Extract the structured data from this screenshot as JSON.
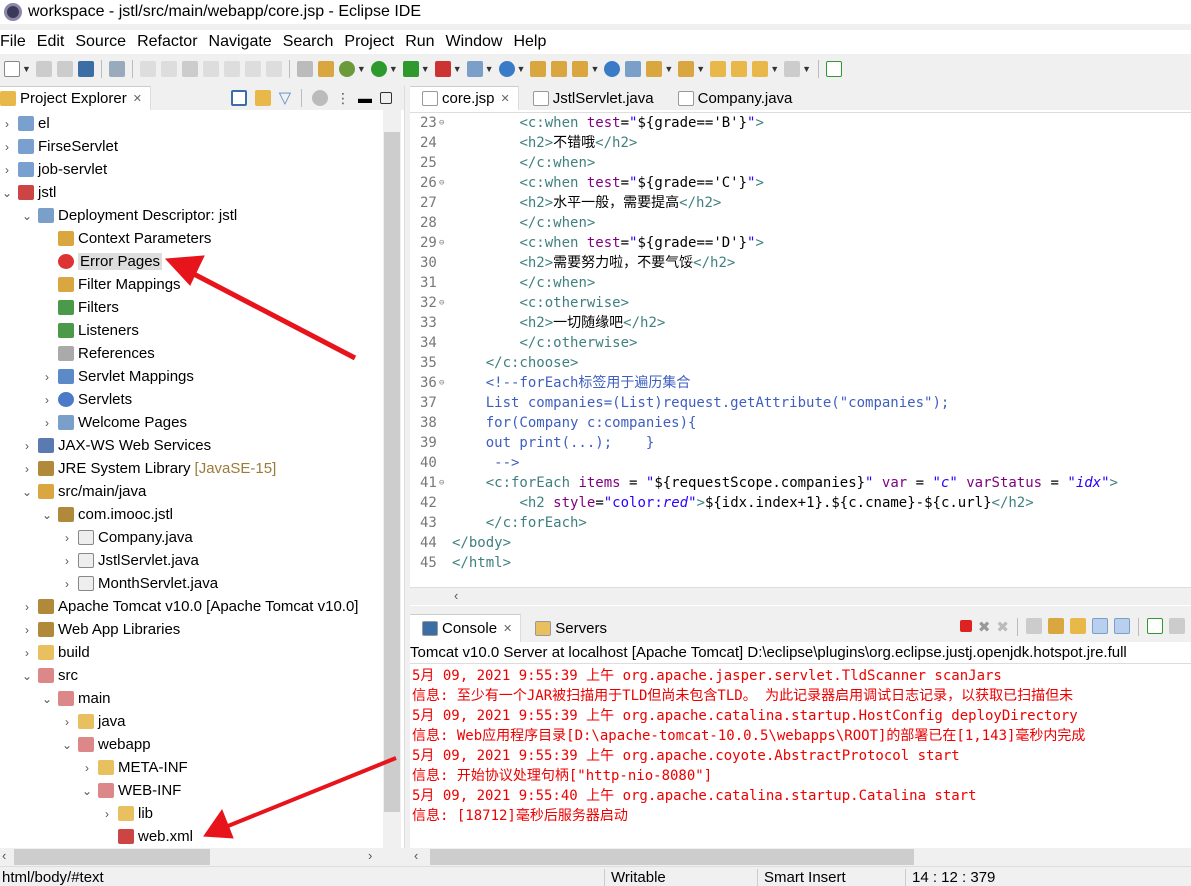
{
  "window": {
    "title": "workspace - jstl/src/main/webapp/core.jsp - Eclipse IDE"
  },
  "menu": [
    "File",
    "Edit",
    "Source",
    "Refactor",
    "Navigate",
    "Search",
    "Project",
    "Run",
    "Window",
    "Help"
  ],
  "explorer": {
    "title": "Project Explorer",
    "items": [
      {
        "label": "el",
        "level": 0,
        "twisty": "closed",
        "icon": "web-project-icon"
      },
      {
        "label": "FirseServlet",
        "level": 0,
        "twisty": "closed",
        "icon": "web-project-icon"
      },
      {
        "label": "job-servlet",
        "level": 0,
        "twisty": "closed",
        "icon": "web-project-icon"
      },
      {
        "label": "jstl",
        "level": 0,
        "twisty": "open",
        "icon": "web-project-error-icon"
      },
      {
        "label": "Deployment Descriptor: jstl",
        "level": 1,
        "twisty": "open",
        "icon": "deployment-descriptor-icon"
      },
      {
        "label": "Context Parameters",
        "level": 2,
        "twisty": "none",
        "icon": "context-params-icon"
      },
      {
        "label": "Error Pages",
        "level": 2,
        "twisty": "none",
        "icon": "error-pages-icon",
        "selected": true
      },
      {
        "label": "Filter Mappings",
        "level": 2,
        "twisty": "none",
        "icon": "filter-mappings-icon"
      },
      {
        "label": "Filters",
        "level": 2,
        "twisty": "none",
        "icon": "filters-icon"
      },
      {
        "label": "Listeners",
        "level": 2,
        "twisty": "none",
        "icon": "listeners-icon"
      },
      {
        "label": "References",
        "level": 2,
        "twisty": "none",
        "icon": "references-icon"
      },
      {
        "label": "Servlet Mappings",
        "level": 2,
        "twisty": "closed",
        "icon": "servlet-mappings-icon"
      },
      {
        "label": "Servlets",
        "level": 2,
        "twisty": "closed",
        "icon": "servlets-icon"
      },
      {
        "label": "Welcome Pages",
        "level": 2,
        "twisty": "closed",
        "icon": "welcome-pages-icon"
      },
      {
        "label": "JAX-WS Web Services",
        "level": 1,
        "twisty": "closed",
        "icon": "web-services-icon"
      },
      {
        "label": "JRE System Library",
        "deco": "[JavaSE-15]",
        "level": 1,
        "twisty": "closed",
        "icon": "library-icon"
      },
      {
        "label": "src/main/java",
        "level": 1,
        "twisty": "open",
        "icon": "source-folder-icon"
      },
      {
        "label": "com.imooc.jstl",
        "level": 2,
        "twisty": "open",
        "icon": "package-icon"
      },
      {
        "label": "Company.java",
        "level": 3,
        "twisty": "closed",
        "icon": "java-file-icon"
      },
      {
        "label": "JstlServlet.java",
        "level": 3,
        "twisty": "closed",
        "icon": "java-file-icon"
      },
      {
        "label": "MonthServlet.java",
        "level": 3,
        "twisty": "closed",
        "icon": "java-file-icon"
      },
      {
        "label": "Apache Tomcat v10.0 [Apache Tomcat v10.0]",
        "level": 1,
        "twisty": "closed",
        "icon": "library-icon"
      },
      {
        "label": "Web App Libraries",
        "level": 1,
        "twisty": "closed",
        "icon": "library-icon"
      },
      {
        "label": "build",
        "level": 1,
        "twisty": "closed",
        "icon": "folder-icon"
      },
      {
        "label": "src",
        "level": 1,
        "twisty": "open",
        "icon": "folder-error-icon"
      },
      {
        "label": "main",
        "level": 2,
        "twisty": "open",
        "icon": "folder-error-icon"
      },
      {
        "label": "java",
        "level": 3,
        "twisty": "closed",
        "icon": "folder-icon"
      },
      {
        "label": "webapp",
        "level": 3,
        "twisty": "open",
        "icon": "folder-error-icon"
      },
      {
        "label": "META-INF",
        "level": 4,
        "twisty": "closed",
        "icon": "folder-icon"
      },
      {
        "label": "WEB-INF",
        "level": 4,
        "twisty": "open",
        "icon": "folder-error-icon"
      },
      {
        "label": "lib",
        "level": 5,
        "twisty": "closed",
        "icon": "folder-icon"
      },
      {
        "label": "web.xml",
        "level": 5,
        "twisty": "none",
        "icon": "xml-file-error-icon"
      }
    ]
  },
  "editor": {
    "tabs": [
      {
        "label": "core.jsp",
        "active": true
      },
      {
        "label": "JstlServlet.java"
      },
      {
        "label": "Company.java"
      }
    ],
    "lines": [
      {
        "n": "23",
        "fold": true,
        "tokens": [
          [
            "tag",
            "\t\t<c:when "
          ],
          [
            "attr",
            "test"
          ],
          [
            "el",
            "="
          ],
          [
            "str",
            "\""
          ],
          [
            "el",
            "${grade=='B'}"
          ],
          [
            "str",
            "\""
          ],
          [
            "tag",
            ">"
          ]
        ]
      },
      {
        "n": "24",
        "tokens": [
          [
            "tag",
            "\t\t<h2>"
          ],
          [
            "txt",
            "不错哦"
          ],
          [
            "tag",
            "</h2>"
          ]
        ]
      },
      {
        "n": "25",
        "tokens": [
          [
            "tag",
            "\t\t</c:when>"
          ]
        ]
      },
      {
        "n": "26",
        "fold": true,
        "tokens": [
          [
            "tag",
            "\t\t<c:when "
          ],
          [
            "attr",
            "test"
          ],
          [
            "el",
            "="
          ],
          [
            "str",
            "\""
          ],
          [
            "el",
            "${grade=='C'}"
          ],
          [
            "str",
            "\""
          ],
          [
            "tag",
            ">"
          ]
        ]
      },
      {
        "n": "27",
        "tokens": [
          [
            "tag",
            "\t\t<h2>"
          ],
          [
            "txt",
            "水平一般，需要提高"
          ],
          [
            "tag",
            "</h2>"
          ]
        ]
      },
      {
        "n": "28",
        "tokens": [
          [
            "tag",
            "\t\t</c:when>"
          ]
        ]
      },
      {
        "n": "29",
        "fold": true,
        "tokens": [
          [
            "tag",
            "\t\t<c:when "
          ],
          [
            "attr",
            "test"
          ],
          [
            "el",
            "="
          ],
          [
            "str",
            "\""
          ],
          [
            "el",
            "${grade=='D'}"
          ],
          [
            "str",
            "\""
          ],
          [
            "tag",
            ">"
          ]
        ]
      },
      {
        "n": "30",
        "tokens": [
          [
            "tag",
            "\t\t<h2>"
          ],
          [
            "txt",
            "需要努力啦，不要气馁"
          ],
          [
            "tag",
            "</h2>"
          ]
        ]
      },
      {
        "n": "31",
        "tokens": [
          [
            "tag",
            "\t\t</c:when>"
          ]
        ]
      },
      {
        "n": "32",
        "fold": true,
        "tokens": [
          [
            "tag",
            "\t\t<c:otherwise>"
          ]
        ]
      },
      {
        "n": "33",
        "tokens": [
          [
            "tag",
            "\t\t<h2>"
          ],
          [
            "txt",
            "一切随缘吧"
          ],
          [
            "tag",
            "</h2>"
          ]
        ]
      },
      {
        "n": "34",
        "tokens": [
          [
            "tag",
            "\t\t</c:otherwise>"
          ]
        ]
      },
      {
        "n": "35",
        "tokens": [
          [
            "tag",
            "\t</c:choose>"
          ]
        ]
      },
      {
        "n": "36",
        "fold": true,
        "tokens": [
          [
            "cm",
            "\t<!--forEach标签用于遍历集合"
          ]
        ]
      },
      {
        "n": "37",
        "tokens": [
          [
            "cm",
            "\tList companies=(List)request.getAttribute(\"companies\");"
          ]
        ]
      },
      {
        "n": "38",
        "tokens": [
          [
            "cm",
            "\tfor(Company c:companies){"
          ]
        ]
      },
      {
        "n": "39",
        "tokens": [
          [
            "cm",
            "\tout print(...);    }"
          ]
        ]
      },
      {
        "n": "40",
        "tokens": [
          [
            "cm",
            "\t -->"
          ]
        ]
      },
      {
        "n": "41",
        "fold": true,
        "tokens": [
          [
            "tag",
            "\t<c:forEach "
          ],
          [
            "attr",
            "items"
          ],
          [
            "el",
            " = "
          ],
          [
            "str",
            "\""
          ],
          [
            "el",
            "${requestScope.companies}"
          ],
          [
            "str",
            "\""
          ],
          [
            "attr",
            " var"
          ],
          [
            "el",
            " = "
          ],
          [
            "stri",
            "\"c\""
          ],
          [
            "attr",
            " varStatus"
          ],
          [
            "el",
            " = "
          ],
          [
            "stri",
            "\"idx\""
          ],
          [
            "tag",
            ">"
          ]
        ]
      },
      {
        "n": "42",
        "tokens": [
          [
            "tag",
            "\t\t<h2 "
          ],
          [
            "attr",
            "style"
          ],
          [
            "el",
            "="
          ],
          [
            "str",
            "\"color:"
          ],
          [
            "stri",
            "red"
          ],
          [
            "str",
            "\""
          ],
          [
            "tag",
            ">"
          ],
          [
            "el",
            "${idx.index+1}.${c.cname}-${c.url}"
          ],
          [
            "tag",
            "</h2>"
          ]
        ]
      },
      {
        "n": "43",
        "tokens": [
          [
            "tag",
            "\t</c:forEach>"
          ]
        ]
      },
      {
        "n": "44",
        "tokens": [
          [
            "tag",
            "</body>"
          ]
        ]
      },
      {
        "n": "45",
        "tokens": [
          [
            "tag",
            "</html>"
          ]
        ]
      }
    ]
  },
  "console": {
    "tabs": [
      {
        "label": "Console",
        "active": true
      },
      {
        "label": "Servers"
      }
    ],
    "header": "Tomcat v10.0 Server at localhost [Apache Tomcat] D:\\eclipse\\plugins\\org.eclipse.justj.openjdk.hotspot.jre.full",
    "lines": [
      "5月 09, 2021 9:55:39 上午 org.apache.jasper.servlet.TldScanner scanJars",
      "信息: 至少有一个JAR被扫描用于TLD但尚未包含TLD。 为此记录器启用调试日志记录，以获取已扫描但未",
      "5月 09, 2021 9:55:39 上午 org.apache.catalina.startup.HostConfig deployDirectory",
      "信息: Web应用程序目录[D:\\apache-tomcat-10.0.5\\webapps\\ROOT]的部署已在[1,143]毫秒内完成",
      "5月 09, 2021 9:55:39 上午 org.apache.coyote.AbstractProtocol start",
      "信息: 开始协议处理句柄[\"http-nio-8080\"]",
      "5月 09, 2021 9:55:40 上午 org.apache.catalina.startup.Catalina start",
      "信息: [18712]毫秒后服务器启动"
    ]
  },
  "status": {
    "path": "html/body/#text",
    "writable": "Writable",
    "insert": "Smart Insert",
    "position": "14 : 12 : 379"
  },
  "colors": {
    "annotation_arrow": "#e8141b",
    "console_text": "#ee0000"
  }
}
